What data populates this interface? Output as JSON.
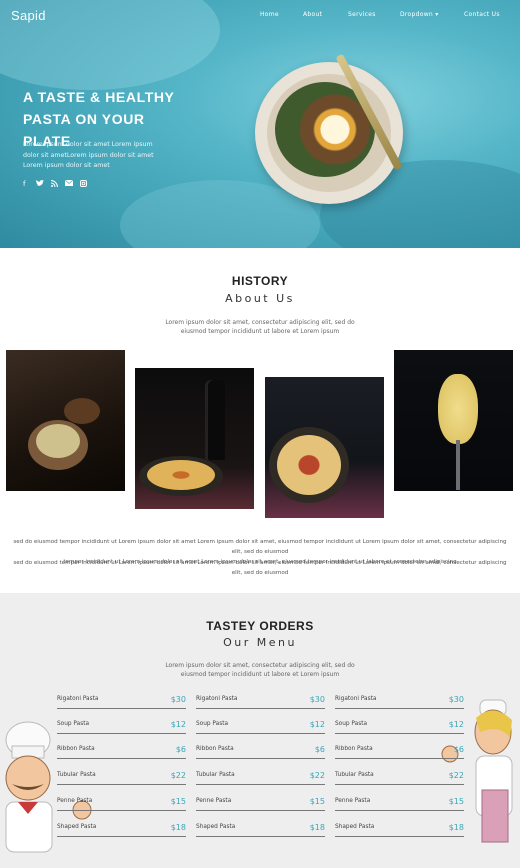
{
  "brand": "Sapid",
  "nav": [
    {
      "label": "Home"
    },
    {
      "label": "About"
    },
    {
      "label": "Services"
    },
    {
      "label": "Dropdown ▾"
    },
    {
      "label": "Contact Us"
    }
  ],
  "hero": {
    "title_line1": "A TASTE & HEALTHY",
    "title_line2": "PASTA ON YOUR PLATE",
    "text": "Lorem ipsum dolor sit amet Lorem ipsum dolor sit ametLorem ipsum dolor sit amet Lorem ipsum dolor sit amet",
    "social": [
      "f",
      "t",
      "rss",
      "mail",
      "insta"
    ]
  },
  "history": {
    "title": "HISTORY",
    "subtitle": "About Us",
    "desc_line1": "Lorem ipsum dolor sit amet, consectetur adipiscing elit, sed do",
    "desc_line2": "eiusmod tempor incididunt ut labore et Lorem ipsum",
    "text_line1": "sed do eiusmod tempor incididunt ut Lorem ipsum dolor sit amet Lorem ipsum dolor sit amet, eiusmod tempor incididunt ut Lorem ipsum dolor sit amet, consectetur adipiscing elit, sed do eiusmod",
    "text_line2": "tempor incididunt ut Lorem ipsum dolor sit amet Lorem ipsum dolor sit amet, eiusmod tempor incididunt ut labore et consectetur adipiscing",
    "text_line3": "sed do eiusmod tempor incididunt ut Lorem ipsum dolor sit amet Lorem ipsum dolor sit amet, eiusmod tempor incididunt ut Lorem ipsum dolor sit amet, consectetur adipiscing elit, sed do eiusmod"
  },
  "menu": {
    "title": "TASTEY ORDERS",
    "subtitle": "Our Menu",
    "desc_line1": "Lorem ipsum dolor sit amet, consectetur adipiscing elit, sed do",
    "desc_line2": "eiusmod tempor incididunt ut labore et Lorem ipsum",
    "columns": [
      [
        {
          "name": "Rigatoni Pasta",
          "price": "$30"
        },
        {
          "name": "Soup Pasta",
          "price": "$12"
        },
        {
          "name": "Ribbon Pasta",
          "price": "$6"
        },
        {
          "name": "Tubular Pasta",
          "price": "$22"
        },
        {
          "name": "Penne Pasta",
          "price": "$15"
        },
        {
          "name": "Shaped Pasta",
          "price": "$18"
        }
      ],
      [
        {
          "name": "Rigatoni Pasta",
          "price": "$30"
        },
        {
          "name": "Soup Pasta",
          "price": "$12"
        },
        {
          "name": "Ribbon Pasta",
          "price": "$6"
        },
        {
          "name": "Tubular Pasta",
          "price": "$22"
        },
        {
          "name": "Penne Pasta",
          "price": "$15"
        },
        {
          "name": "Shaped Pasta",
          "price": "$18"
        }
      ],
      [
        {
          "name": "Rigatoni Pasta",
          "price": "$30"
        },
        {
          "name": "Soup Pasta",
          "price": "$12"
        },
        {
          "name": "Ribbon Pasta",
          "price": "$6"
        },
        {
          "name": "Tubular Pasta",
          "price": "$22"
        },
        {
          "name": "Penne Pasta",
          "price": "$15"
        },
        {
          "name": "Shaped Pasta",
          "price": "$18"
        }
      ]
    ]
  },
  "colors": {
    "accent": "#3aa6b9",
    "hero_bg": "#55b6c8",
    "menu_bg": "#eeeeee"
  }
}
